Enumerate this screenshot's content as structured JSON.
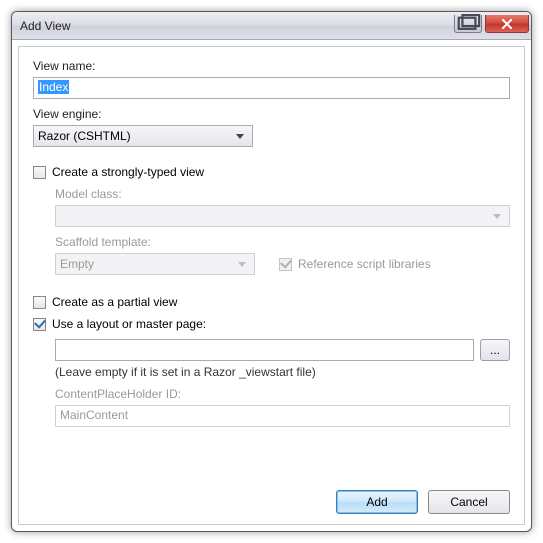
{
  "title": "Add View",
  "viewName": {
    "label": "View name:",
    "value": "Index"
  },
  "viewEngine": {
    "label": "View engine:",
    "value": "Razor (CSHTML)"
  },
  "stronglyTyped": {
    "label": "Create a strongly-typed view",
    "checked": false
  },
  "modelClass": {
    "label": "Model class:",
    "value": ""
  },
  "scaffold": {
    "label": "Scaffold template:",
    "value": "Empty"
  },
  "refScripts": {
    "label": "Reference script libraries",
    "checked": true
  },
  "partial": {
    "label": "Create as a partial view",
    "checked": false
  },
  "useLayout": {
    "label": "Use a layout or master page:",
    "checked": true
  },
  "layoutPath": {
    "value": ""
  },
  "layoutHint": "(Leave empty if it is set in a Razor _viewstart file)",
  "cph": {
    "label": "ContentPlaceHolder ID:",
    "value": "MainContent"
  },
  "browse": "...",
  "add": "Add",
  "cancel": "Cancel"
}
